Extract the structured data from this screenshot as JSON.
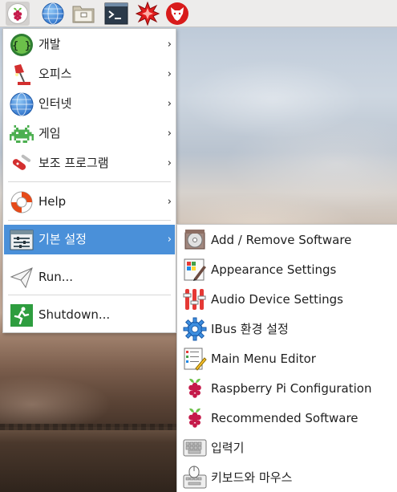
{
  "panel": {
    "launchers": [
      {
        "name": "raspberry-menu-button",
        "icon": "raspberry-icon"
      },
      {
        "name": "web-browser-launcher",
        "icon": "globe-icon"
      },
      {
        "name": "file-manager-launcher",
        "icon": "folder-icon"
      },
      {
        "name": "terminal-launcher",
        "icon": "terminal-icon"
      },
      {
        "name": "mathematica-launcher",
        "icon": "mathematica-icon"
      },
      {
        "name": "wolfram-launcher",
        "icon": "wolfram-icon"
      }
    ]
  },
  "main_menu": {
    "items": [
      {
        "label": "개발",
        "icon": "programming-icon",
        "has_submenu": true
      },
      {
        "label": "오피스",
        "icon": "office-lamp-icon",
        "has_submenu": true
      },
      {
        "label": "인터넷",
        "icon": "globe-icon",
        "has_submenu": true
      },
      {
        "label": "게임",
        "icon": "games-invader-icon",
        "has_submenu": true
      },
      {
        "label": "보조 프로그램",
        "icon": "accessories-knife-icon",
        "has_submenu": true
      },
      {
        "label": "Help",
        "icon": "lifebuoy-icon",
        "has_submenu": true
      },
      {
        "label": "기본 설정",
        "icon": "preferences-icon",
        "has_submenu": true,
        "selected": true
      },
      {
        "label": "Run...",
        "icon": "paper-plane-icon",
        "has_submenu": false
      },
      {
        "label": "Shutdown...",
        "icon": "exit-running-man-icon",
        "has_submenu": false
      }
    ],
    "arrow": "›"
  },
  "sub_menu": {
    "items": [
      {
        "label": "Add / Remove Software",
        "icon": "package-disc-icon"
      },
      {
        "label": "Appearance Settings",
        "icon": "appearance-palette-icon"
      },
      {
        "label": "Audio Device Settings",
        "icon": "audio-mixer-icon"
      },
      {
        "label": "IBus 환경 설정",
        "icon": "gear-icon"
      },
      {
        "label": "Main Menu Editor",
        "icon": "menu-editor-icon"
      },
      {
        "label": "Raspberry Pi Configuration",
        "icon": "raspberry-icon"
      },
      {
        "label": "Recommended Software",
        "icon": "raspberry-icon"
      },
      {
        "label": "입력기",
        "icon": "keyboard-icon"
      },
      {
        "label": "키보드와 마우스",
        "icon": "keyboard-mouse-icon"
      }
    ]
  },
  "colors": {
    "selection": "#4a90d9",
    "panel": "#edeceb",
    "raspberry_red": "#c51a4a",
    "leaf_green": "#6cc04a"
  }
}
